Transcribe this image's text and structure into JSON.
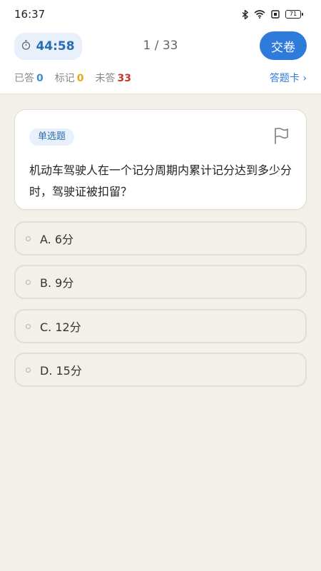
{
  "status_bar": {
    "time": "16:37",
    "battery": "71",
    "icons": [
      "bluetooth-icon",
      "wifi-icon",
      "sim-icon",
      "battery-icon"
    ]
  },
  "header": {
    "timer_icon": "stopwatch-icon",
    "timer": "44:58",
    "progress": "1 / 33",
    "submit_label": "交卷",
    "stats": {
      "answered_label": "已答",
      "answered_count": "0",
      "marked_label": "标记",
      "marked_count": "0",
      "unanswered_label": "未答",
      "unanswered_count": "33"
    },
    "answer_card_label": "答题卡 ›"
  },
  "question": {
    "type": "单选题",
    "flag_icon": "flag-icon",
    "text": "机动车驾驶人在一个记分周期内累计记分达到多少分时，驾驶证被扣留？"
  },
  "options": [
    {
      "label": "A. 6分"
    },
    {
      "label": "B. 9分"
    },
    {
      "label": "C. 12分"
    },
    {
      "label": "D. 15分"
    }
  ],
  "colors": {
    "accent": "#2f7bdc",
    "background": "#f3f0e9",
    "answered": "#3a8fd0",
    "marked": "#e6a817",
    "unanswered": "#c0392b"
  }
}
